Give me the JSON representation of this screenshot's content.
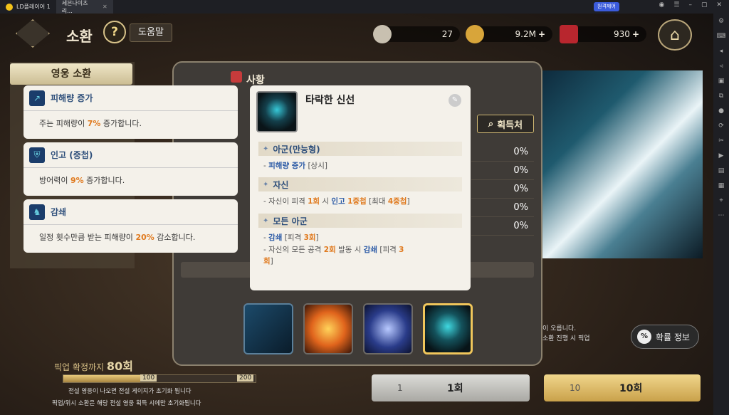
{
  "window": {
    "tabs": [
      {
        "label": "LD플레이어 1",
        "active": false
      },
      {
        "label": "세븐나이츠 리...",
        "active": true
      }
    ],
    "remote_label": "원격제어"
  },
  "hud": {
    "title": "소환",
    "help_mark": "?",
    "help_label": "도움말",
    "currencies": [
      {
        "name": "ticket",
        "value": "27",
        "plus": ""
      },
      {
        "name": "gold",
        "value": "9.2M",
        "plus": "+"
      },
      {
        "name": "ruby",
        "value": "930",
        "plus": "+"
      }
    ]
  },
  "left": {
    "hero_summon_label": "영웅 소환",
    "pickup_prefix": "픽업",
    "pickup_text": "확정까지",
    "pickup_count": "80회",
    "bar_marks": [
      "100",
      "200"
    ],
    "bar_fill_fraction": 0.4,
    "notes": [
      "전설 영웅이 나오면 전설 게이지가 초기화 됩니다",
      "픽업/위시 소환은 해당 전설 영웅 획득 시에만 초기화됩니다"
    ]
  },
  "dialog": {
    "top_label": "사황",
    "source_label": "획득처",
    "percent_rows": [
      "0%",
      "0%",
      "0%",
      "0%",
      "0%"
    ]
  },
  "tooltips": [
    {
      "name": "피해량 증가",
      "icon": "arrow-icon",
      "desc_pre": "주는 피해량이 ",
      "desc_hl": "7%",
      "desc_post": " 증가합니다."
    },
    {
      "name": "인고 (중첩)",
      "icon": "shield-icon",
      "desc_pre": "방어력이 ",
      "desc_hl": "9%",
      "desc_post": " 증가합니다."
    },
    {
      "name": "감쇄",
      "icon": "figure-icon",
      "desc_pre": "일정 횟수만큼 받는 피해량이 ",
      "desc_hl": "20%",
      "desc_post": " 감소합니다."
    }
  ],
  "card": {
    "title": "타락한 신선",
    "sections": [
      {
        "label": "아군(만능형)",
        "lines": [
          [
            {
              "t": "- "
            },
            {
              "t": "피해량 증가",
              "c": "blue"
            },
            {
              "t": " [상시]"
            }
          ]
        ]
      },
      {
        "label": "자신",
        "lines": [
          [
            {
              "t": "- 자신이 피격 "
            },
            {
              "t": "1회",
              "c": "orange"
            },
            {
              "t": " 시 "
            },
            {
              "t": "인고",
              "c": "blue"
            },
            {
              "t": " "
            },
            {
              "t": "1중첩",
              "c": "orange"
            },
            {
              "t": " [최대 "
            },
            {
              "t": "4중첩",
              "c": "orange"
            },
            {
              "t": "]"
            }
          ]
        ]
      },
      {
        "label": "모든 아군",
        "lines": [
          [
            {
              "t": "- "
            },
            {
              "t": "감쇄",
              "c": "blue"
            },
            {
              "t": " [피격 "
            },
            {
              "t": "3회",
              "c": "orange"
            },
            {
              "t": "]"
            }
          ],
          [
            {
              "t": "- 자신의 모든 공격 "
            },
            {
              "t": "2회",
              "c": "orange"
            },
            {
              "t": " 발동 시 "
            },
            {
              "t": "감쇄",
              "c": "blue"
            },
            {
              "t": " [피격 "
            },
            {
              "t": "3",
              "c": "orange"
            }
          ],
          [
            {
              "t": "회",
              "c": "orange"
            },
            {
              "t": "]"
            }
          ]
        ]
      }
    ]
  },
  "skills": [
    {
      "name": "sword-slash-skill",
      "selected": false
    },
    {
      "name": "explosion-skill",
      "selected": false
    },
    {
      "name": "spear-skill",
      "selected": false
    },
    {
      "name": "dark-sage-skill",
      "selected": true
    }
  ],
  "right_notes": [
    "이 오릅니다.",
    "소환 진행 시 픽업"
  ],
  "prob_label": "확률 정보",
  "prob_icon_text": "%",
  "summon_buttons": [
    {
      "count": "1",
      "label": "1회"
    },
    {
      "count": "10",
      "label": "10회"
    }
  ]
}
